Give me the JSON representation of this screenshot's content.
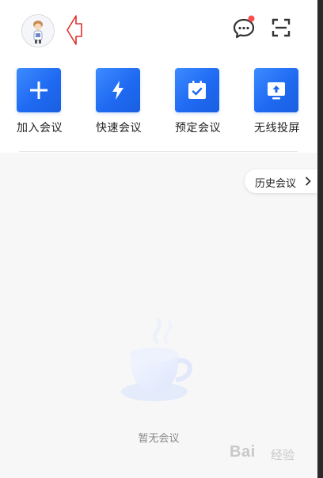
{
  "header": {
    "avatar_icon": "user-avatar",
    "pointer_icon": "red-outline-arrow-left",
    "chat_icon": "chat-bubble-icon",
    "chat_has_notification": true,
    "scan_icon": "scan-icon"
  },
  "actions": [
    {
      "label": "加入会议",
      "icon": "plus-icon"
    },
    {
      "label": "快速会议",
      "icon": "lightning-icon"
    },
    {
      "label": "预定会议",
      "icon": "calendar-check-icon"
    },
    {
      "label": "无线投屏",
      "icon": "screen-cast-icon"
    }
  ],
  "history_button": {
    "label": "历史会议"
  },
  "empty_state": {
    "text": "暂无会议",
    "icon": "coffee-cup-icon"
  },
  "watermark": {
    "logo": "Bai",
    "sub": "经验"
  },
  "colors": {
    "accent": "#1f6af2",
    "notification_dot": "#ff4d4f",
    "pointer_outline": "#e0302a"
  }
}
